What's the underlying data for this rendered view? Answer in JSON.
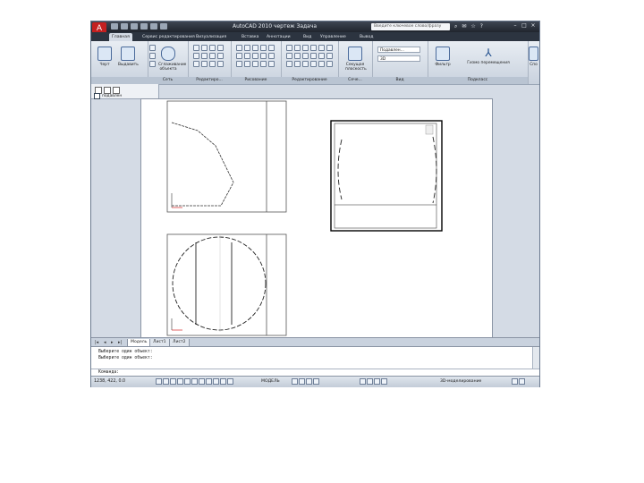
{
  "window": {
    "title": "AutoCAD 2010   чертеж Задача",
    "search_placeholder": "Введите ключевое слово/фразу",
    "app_button_icon": "A"
  },
  "ribbon_tabs": [
    "Главная",
    "Сервис редактирования",
    "Визуализация",
    "Вставка",
    "Аннотации",
    "Вид",
    "Управление",
    "Вывод"
  ],
  "ribbon": {
    "draw": {
      "buttons": [
        "Черт",
        "Выдавить"
      ],
      "title": ""
    },
    "mesh": {
      "buttons": [
        "Сглаживание объекта"
      ],
      "title": "Сеть"
    },
    "solid_edit": {
      "title": "Редактиро..."
    },
    "draw_panel": {
      "title": "Рисование"
    },
    "modify": {
      "title": "Редактирование"
    },
    "section": {
      "buttons": [
        "Секущая плоскость"
      ],
      "title": "Сече..."
    },
    "view": {
      "dropdown1": "Подавлен...",
      "dropdown2": "3D",
      "title": "Вид"
    },
    "coords_panel": {
      "buttons": [
        "Фильтр",
        "Гизмо перемещения"
      ],
      "title": "Подкласс"
    },
    "last": {
      "label": "Спо"
    }
  },
  "palette": {
    "checkbox_label": "подавлен"
  },
  "layout_tabs": [
    "Модель",
    "Лист1",
    "Лист2"
  ],
  "command_history": [
    "Выберите один объект:",
    "Выберите один объект:"
  ],
  "command_prompt": "Команда:",
  "status": {
    "coords": "1238, 422, 0.0",
    "scale_text": "МОДЕЛЬ",
    "workspace": "3D-моделирование"
  },
  "colors": {
    "app_red": "#c42020",
    "title_dark": "#20252d",
    "ribbon_light": "#e8edf3"
  }
}
